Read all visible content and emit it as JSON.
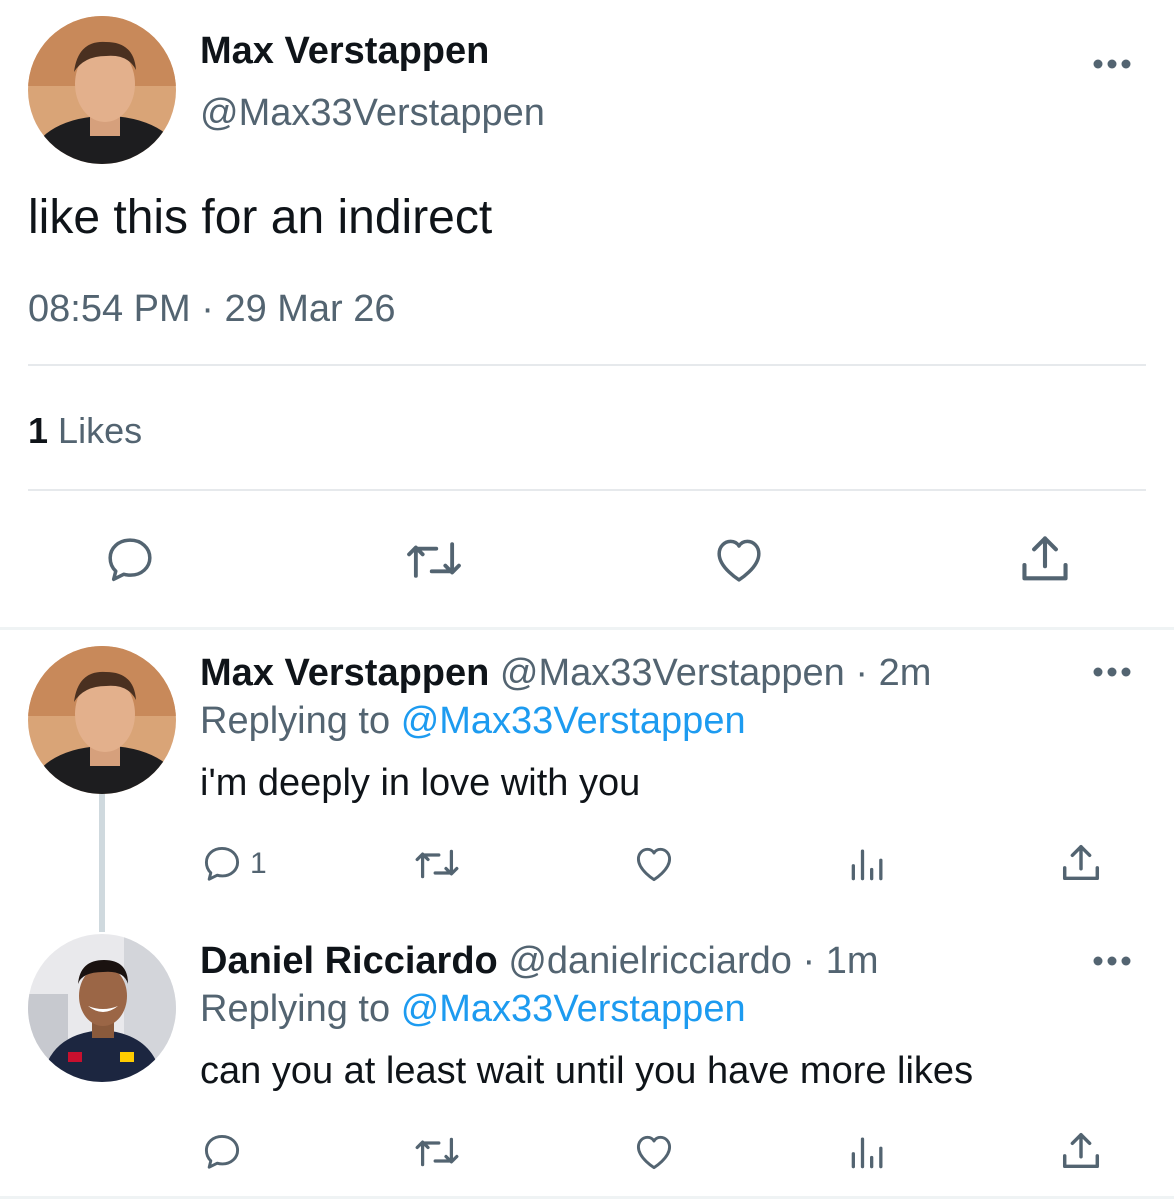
{
  "main_tweet": {
    "name": "Max Verstappen",
    "handle": "@Max33Verstappen",
    "text": "like this for an indirect",
    "time": "08:54 PM",
    "separator": "·",
    "date": "29 Mar 26",
    "likes_count": "1",
    "likes_label": "Likes"
  },
  "replies": [
    {
      "name": "Max Verstappen",
      "handle": "@Max33Verstappen",
      "separator": "·",
      "age": "2m",
      "replying_prefix": "Replying to",
      "replying_to": "@Max33Verstappen",
      "text": "i'm deeply in love with you",
      "reply_count": "1"
    },
    {
      "name": "Daniel Ricciardo",
      "handle": "@danielricciardo",
      "separator": "·",
      "age": "1m",
      "replying_prefix": "Replying to",
      "replying_to": "@Max33Verstappen",
      "text": "can you at least wait until you have more likes",
      "reply_count": ""
    }
  ],
  "colors": {
    "text": "#0f1419",
    "muted": "#536471",
    "link": "#1d9bf0",
    "divider": "#e6e9ec"
  },
  "icons": [
    "more-icon",
    "reply-icon",
    "retweet-icon",
    "like-icon",
    "share-icon",
    "analytics-icon"
  ]
}
